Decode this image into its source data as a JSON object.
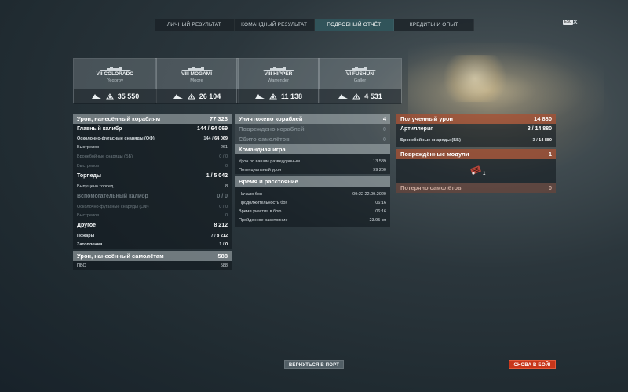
{
  "tabs": [
    {
      "label": "ЛИЧНЫЙ РЕЗУЛЬТАТ"
    },
    {
      "label": "КОМАНДНЫЙ РЕЗУЛЬТАТ"
    },
    {
      "label": "ПОДРОБНЫЙ ОТЧЁТ"
    },
    {
      "label": "КРЕДИТЫ И ОПЫТ"
    }
  ],
  "active_tab": 2,
  "esc_label": "ESC",
  "close_glyph": "✕",
  "ships": [
    {
      "name": "VII COLORADO",
      "player": "Yegorov",
      "damage": "35 550"
    },
    {
      "name": "VIII MOGAMI",
      "player": "Moore",
      "damage": "26 104"
    },
    {
      "name": "VIII HIPPER",
      "player": "Warrender",
      "damage": "11 138"
    },
    {
      "name": "VI FUSHUN",
      "player": "Galler",
      "damage": "4 531"
    }
  ],
  "left": {
    "ship_damage": {
      "label": "Урон, нанесённый кораблям",
      "value": "77 323"
    },
    "main_battery": {
      "label": "Главный калибр",
      "value_a": "144",
      "value_b": "64 069"
    },
    "he_shells": {
      "label": "Осколочно-фугасные снаряды (ОФ)",
      "value_a": "144",
      "value_b": "64 069"
    },
    "shots": {
      "label": "Выстрелов",
      "value": "261"
    },
    "ap_shells": {
      "label": "Бронебойные снаряды (ББ)",
      "value": "0 / 0"
    },
    "ap_shots": {
      "label": "Выстрелов",
      "value": "0"
    },
    "torpedoes": {
      "label": "Торпеды",
      "value_a": "1",
      "value_b": "5 042"
    },
    "torps_launched": {
      "label": "Выпущено торпед",
      "value": "8"
    },
    "secondary": {
      "label": "Вспомогательный калибр",
      "value": "0 / 0"
    },
    "sec_he": {
      "label": "Осколочно-фугасные снаряды (ОФ)",
      "value": "0 / 0"
    },
    "sec_shots": {
      "label": "Выстрелов",
      "value": "0"
    },
    "other": {
      "label": "Другое",
      "value": "8 212"
    },
    "fires": {
      "label": "Пожары",
      "value_a": "7",
      "value_b": "8 212"
    },
    "floods": {
      "label": "Затопления",
      "value_a": "1",
      "value_b": "0"
    },
    "plane_damage": {
      "label": "Урон, нанесённый самолётам",
      "value": "588"
    },
    "aa": {
      "label": "ПВО",
      "value": "588"
    }
  },
  "middle": {
    "destroyed": {
      "label": "Уничтожено кораблей",
      "value": "4"
    },
    "damaged": {
      "label": "Повреждено кораблей",
      "value": "0"
    },
    "planes_shot": {
      "label": "Сбито самолётов",
      "value": "0"
    },
    "team_play": {
      "label": "Командная игра"
    },
    "spotting_damage": {
      "label": "Урон по вашим разведданным",
      "value": "13 589"
    },
    "potential_damage": {
      "label": "Потенциальный урон",
      "value": "99 200"
    },
    "time_distance": {
      "label": "Время и расстояние"
    },
    "battle_start": {
      "label": "Начало боя",
      "value": "09:22  22.09.2020"
    },
    "battle_duration": {
      "label": "Продолжительность боя",
      "value": "06:16"
    },
    "participation": {
      "label": "Время участия в бою",
      "value": "06:16"
    },
    "distance": {
      "label": "Пройденное расстояние",
      "value": "23.95 км"
    }
  },
  "right": {
    "received": {
      "label": "Полученный урон",
      "value": "14 880"
    },
    "artillery": {
      "label": "Артиллерия",
      "value_a": "3",
      "value_b": "14 880"
    },
    "ap_received": {
      "label": "Бронебойные снаряды (ББ)",
      "value_a": "3",
      "value_b": "14 880"
    },
    "modules": {
      "label": "Повреждённые модули",
      "value": "1"
    },
    "module_count": "1",
    "planes_lost": {
      "label": "Потеряно самолётов",
      "value": "0"
    }
  },
  "buttons": {
    "port": "ВЕРНУТЬСЯ В ПОРТ",
    "battle": "СНОВА В БОЙ!"
  },
  "colors": {
    "accent_tab": "#407880",
    "damage_red": "#aa5032",
    "battle_button": "#c8361a"
  }
}
